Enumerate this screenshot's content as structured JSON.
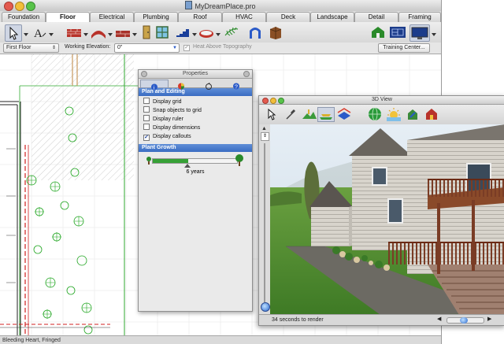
{
  "window": {
    "title": "MyDreamPlace.pro"
  },
  "tabs": [
    {
      "label": "Foundation"
    },
    {
      "label": "Floor",
      "active": true
    },
    {
      "label": "Electrical"
    },
    {
      "label": "Plumbing"
    },
    {
      "label": "Roof"
    },
    {
      "label": "HVAC"
    },
    {
      "label": "Deck"
    },
    {
      "label": "Landscape"
    },
    {
      "label": "Detail"
    },
    {
      "label": "Framing"
    }
  ],
  "options": {
    "floor_value": "First Floor",
    "elevation_label": "Working Elevation:",
    "elevation_value": "0\"",
    "height_topo_label": "Heat Above Topography",
    "training_button": "Training Center..."
  },
  "properties": {
    "title": "Properties",
    "section_plan": "Plan and Editing",
    "options": [
      {
        "label": "Display grid",
        "checked": false
      },
      {
        "label": "Snap objects to grid",
        "checked": false
      },
      {
        "label": "Display ruler",
        "checked": false
      },
      {
        "label": "Display dimensions",
        "checked": false
      },
      {
        "label": "Display callouts",
        "checked": true
      }
    ],
    "section_growth": "Plant Growth",
    "growth_value": "6 years",
    "growth_fraction": 0.42
  },
  "view3d": {
    "title": "3D View",
    "status": "34 seconds to render"
  },
  "statusbar": {
    "text": "Bleeding Heart, Fringed"
  },
  "colors": {
    "plan_green": "#2faa2f",
    "selection_blue": "#3a6cc2"
  }
}
